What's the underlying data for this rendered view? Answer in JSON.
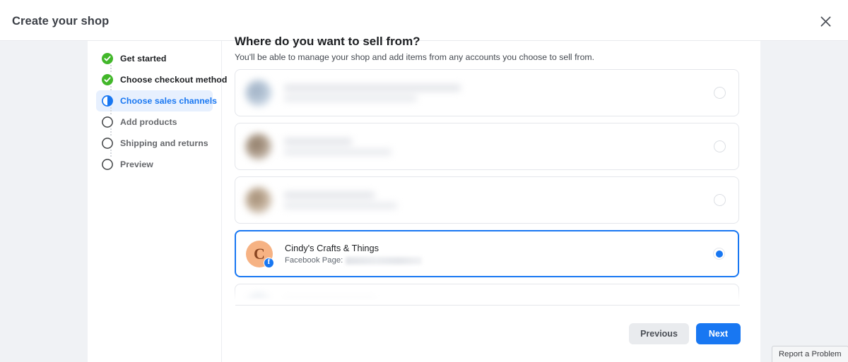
{
  "header": {
    "title": "Create your shop",
    "close_icon": "close-icon"
  },
  "sidebar": {
    "steps": [
      {
        "label": "Get started",
        "state": "done",
        "icon": "check-circle-icon"
      },
      {
        "label": "Choose checkout method",
        "state": "done",
        "icon": "check-circle-icon"
      },
      {
        "label": "Choose sales channels",
        "state": "active",
        "icon": "half-circle-icon"
      },
      {
        "label": "Add products",
        "state": "todo",
        "icon": "empty-circle-icon"
      },
      {
        "label": "Shipping and returns",
        "state": "todo",
        "icon": "empty-circle-icon"
      },
      {
        "label": "Preview",
        "state": "todo",
        "icon": "empty-circle-icon"
      }
    ]
  },
  "main": {
    "title": "Where do you want to sell from?",
    "subtitle": "You'll be able to manage your shop and add items from any accounts you choose to sell from.",
    "accounts": [
      {
        "name": "",
        "meta_label": "",
        "selected": false,
        "redacted": true
      },
      {
        "name": "",
        "meta_label": "",
        "selected": false,
        "redacted": true
      },
      {
        "name": "",
        "meta_label": "",
        "selected": false,
        "redacted": true
      },
      {
        "name": "Cindy's Crafts & Things",
        "meta_label": "Facebook Page:",
        "meta_value_redacted": true,
        "avatar_letter": "C",
        "avatar_badge": "facebook-badge-icon",
        "selected": true,
        "redacted": false
      },
      {
        "name": "",
        "meta_label": "",
        "selected": false,
        "redacted": true
      }
    ]
  },
  "footer": {
    "previous_label": "Previous",
    "next_label": "Next"
  },
  "report": {
    "label": "Report a Problem"
  },
  "colors": {
    "brand_blue": "#1877f2",
    "done_green": "#42b72a",
    "canvas_gray": "#f0f2f5",
    "avatar_peach": "#f6b283",
    "avatar_letter": "#8a4521"
  }
}
